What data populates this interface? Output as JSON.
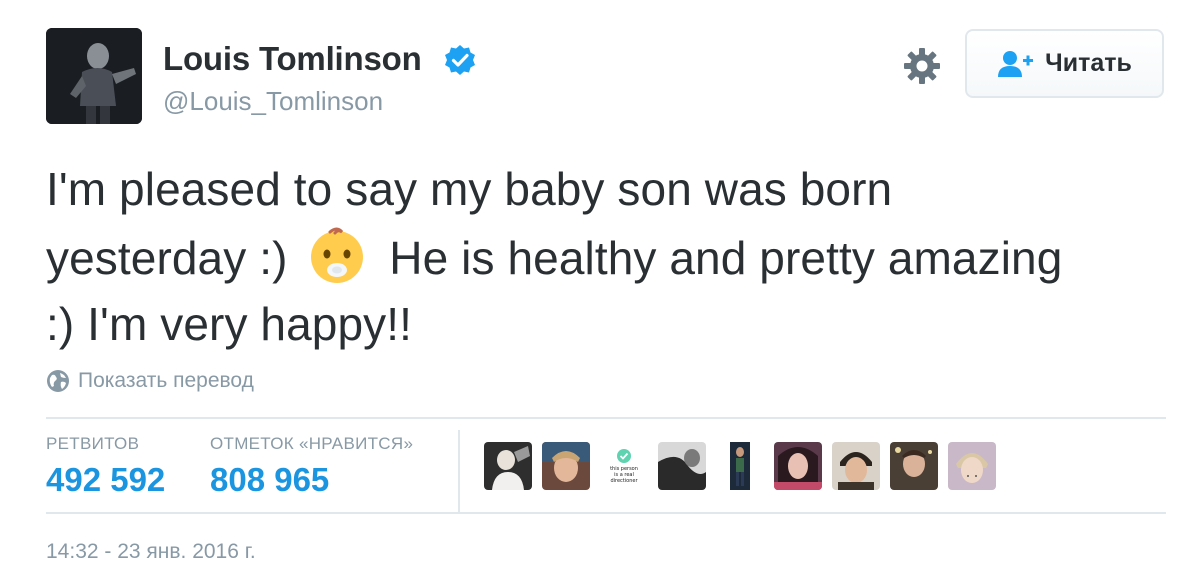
{
  "user": {
    "display_name": "Louis Tomlinson",
    "handle": "@Louis_Tomlinson",
    "verified": true
  },
  "follow_button": {
    "label": "Читать",
    "icon": "add-user-icon"
  },
  "settings": {
    "icon": "gear-icon"
  },
  "tweet": {
    "lines": [
      "I'm pleased to say my baby son was born",
      "yesterday :)",
      "He is healthy and pretty amazing",
      ":) I'm very happy!!"
    ],
    "emoji": "baby-face-emoji"
  },
  "translate": {
    "icon": "globe-icon",
    "label": "Показать перевод"
  },
  "stats": {
    "retweets_label": "РЕТВИТОВ",
    "retweets_value": "492 592",
    "likes_label": "ОТМЕТОК «НРАВИТСЯ»",
    "likes_value": "808 965"
  },
  "likers": [
    {
      "name": "liker-avatar-1",
      "bg": "#2e2e2e"
    },
    {
      "name": "liker-avatar-2",
      "bg": "#6b4a3d"
    },
    {
      "name": "liker-avatar-3",
      "bg": "#ffffff",
      "text": "this person is a real directioner"
    },
    {
      "name": "liker-avatar-4",
      "bg": "#3a3a3a"
    },
    {
      "name": "liker-avatar-5",
      "bg": "#1c2a3a"
    },
    {
      "name": "liker-avatar-6",
      "bg": "#5a3a4a"
    },
    {
      "name": "liker-avatar-7",
      "bg": "#3d342c"
    },
    {
      "name": "liker-avatar-8",
      "bg": "#4a3f35"
    },
    {
      "name": "liker-avatar-9",
      "bg": "#c9b8c8"
    }
  ],
  "timestamp": "14:32 - 23 янв. 2016 г.",
  "colors": {
    "link_blue": "#1b95e0",
    "verified_blue": "#1da1f2",
    "muted": "#8899a6",
    "text": "#292f33",
    "border": "#e1e8ed"
  }
}
